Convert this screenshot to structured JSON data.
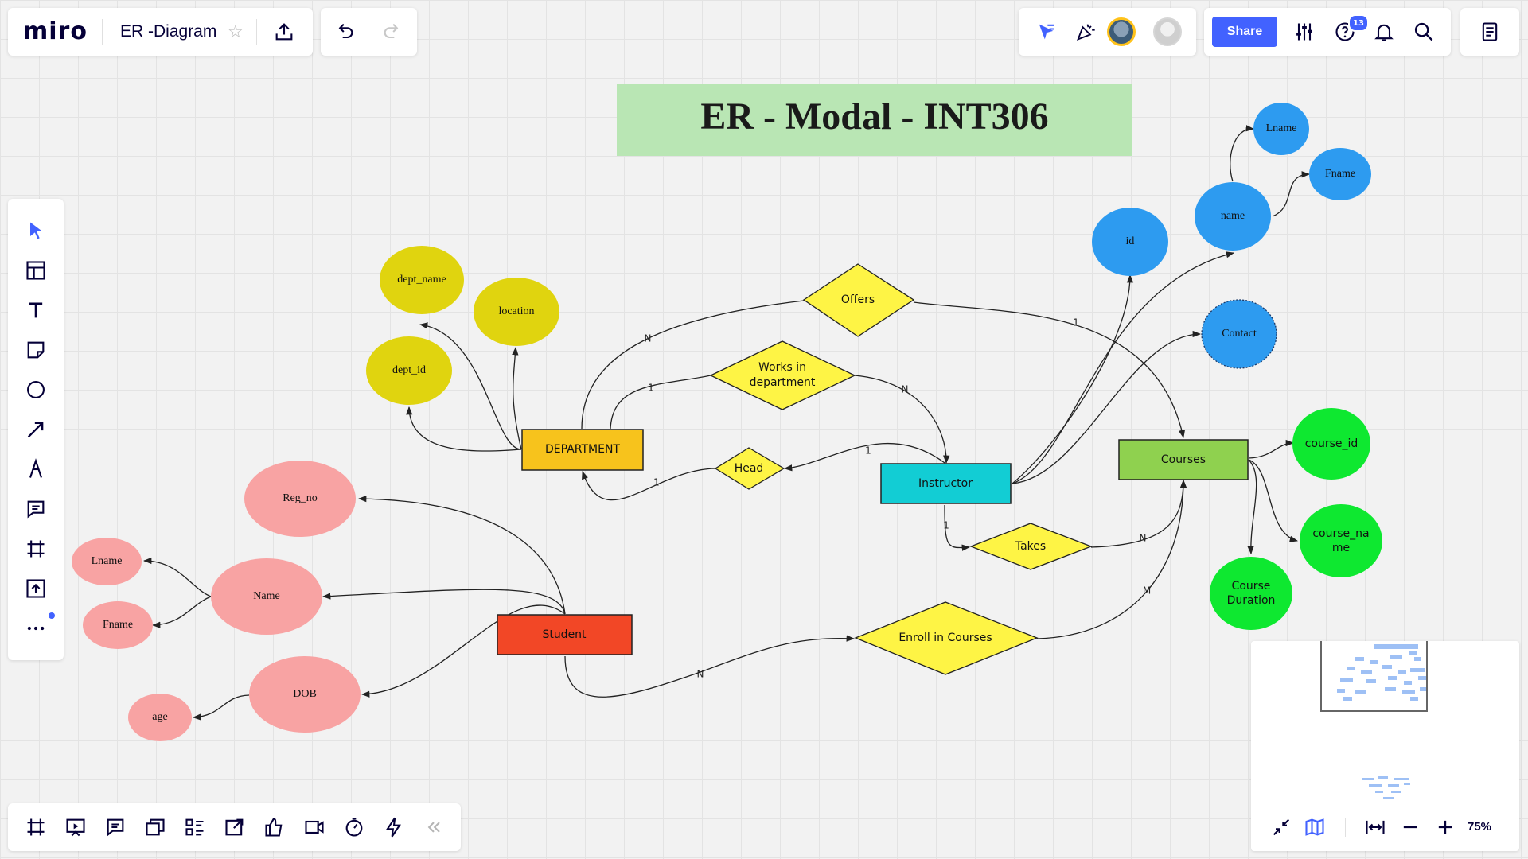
{
  "app": {
    "logo": "miro",
    "board_title": "ER -Diagram"
  },
  "header": {
    "share_label": "Share",
    "notification_badge": "13"
  },
  "diagram": {
    "title": "ER - Modal - INT306",
    "entities": {
      "department": "DEPARTMENT",
      "instructor": "Instructor",
      "courses": "Courses",
      "student": "Student"
    },
    "relationships": {
      "offers": "Offers",
      "works_in_line1": "Works in",
      "works_in_line2": "department",
      "head": "Head",
      "takes": "Takes",
      "enroll": "Enroll in Courses"
    },
    "attributes": {
      "dept_name": "dept_name",
      "location": "location",
      "dept_id": "dept_id",
      "reg_no": "Reg_no",
      "name_student": "Name",
      "lname_student": "Lname",
      "fname_student": "Fname",
      "dob": "DOB",
      "age": "age",
      "id": "id",
      "name_instr": "name",
      "lname_instr": "Lname",
      "fname_instr": "Fname",
      "contact": "Contact",
      "course_id": "course_id",
      "course_name_line1": "course_na",
      "course_name_line2": "me",
      "course_duration_line1": "Course",
      "course_duration_line2": "Duration"
    },
    "cardinalities": {
      "offers_dept": "N",
      "offers_courses": "1",
      "works_dept": "1",
      "works_instr": "N",
      "head_instr": "1",
      "head_dept": "1",
      "takes_instr": "1",
      "takes_courses": "N",
      "enroll_student": "N",
      "enroll_courses": "M"
    },
    "colors": {
      "title_bg": "#b9e6b4",
      "dept_attr": "#e0d40f",
      "dept_entity": "#f7c31c",
      "relationship": "#fef445",
      "instructor_entity": "#12cdd4",
      "instructor_attr": "#2d9bf0",
      "courses_entity": "#8fd14f",
      "courses_attr": "#0ee830",
      "student_entity": "#f24726",
      "student_attr": "#f8a3a3"
    }
  },
  "zoom": {
    "level": "75%"
  }
}
